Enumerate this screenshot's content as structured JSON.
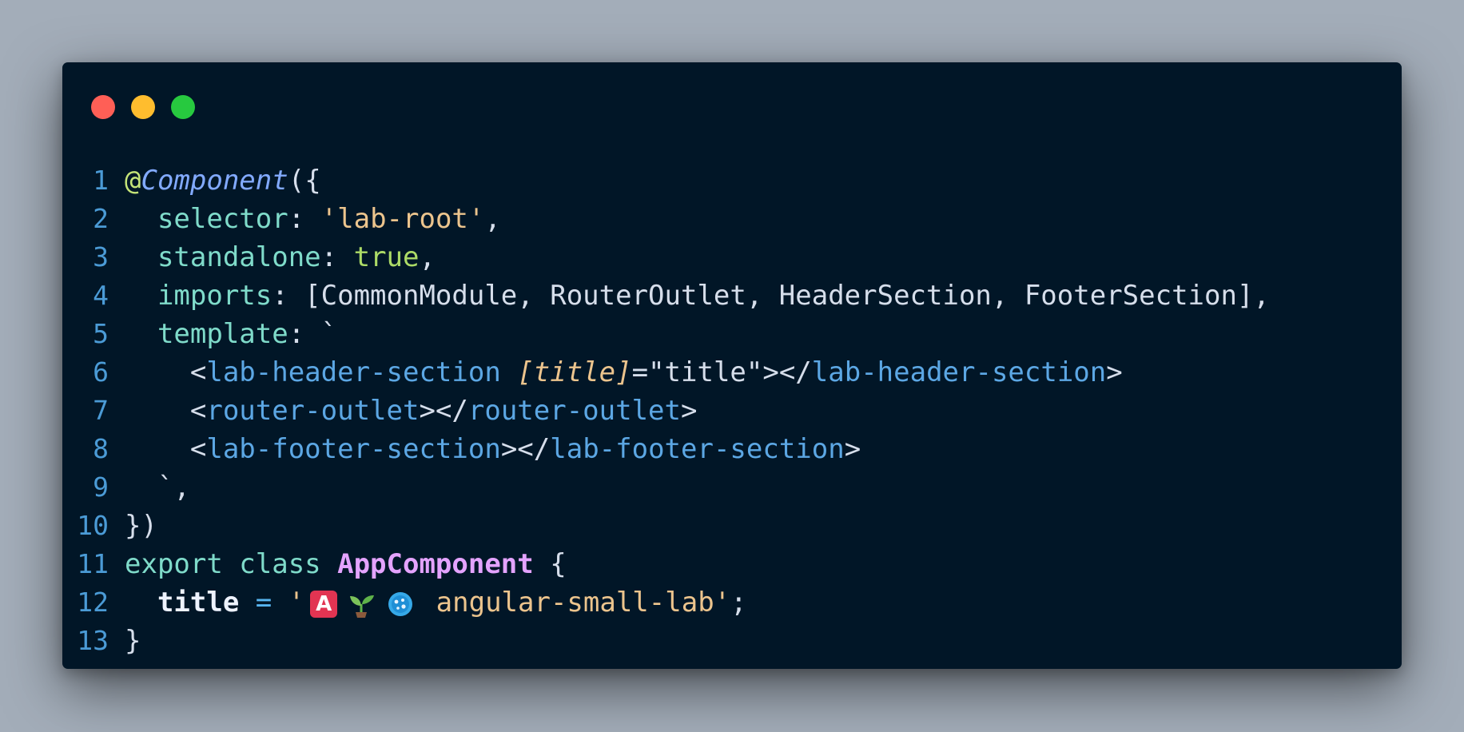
{
  "window": {
    "controls": [
      "close",
      "minimize",
      "maximize"
    ],
    "colors": {
      "close": "#ff5f56",
      "minimize": "#ffbd2e",
      "maximize": "#27c93f",
      "background": "#011627"
    }
  },
  "code": {
    "language": "typescript",
    "line_numbers": [
      "1",
      "2",
      "3",
      "4",
      "5",
      "6",
      "7",
      "8",
      "9",
      "10",
      "11",
      "12",
      "13"
    ],
    "lines": [
      [
        {
          "t": "at",
          "v": "@"
        },
        {
          "t": "decor",
          "v": "Component"
        },
        {
          "t": "punc",
          "v": "({"
        }
      ],
      [
        {
          "t": "prop",
          "v": "  selector"
        },
        {
          "t": "punc",
          "v": ": "
        },
        {
          "t": "str",
          "v": "'lab-root'"
        },
        {
          "t": "punc",
          "v": ","
        }
      ],
      [
        {
          "t": "prop",
          "v": "  standalone"
        },
        {
          "t": "punc",
          "v": ": "
        },
        {
          "t": "bool",
          "v": "true"
        },
        {
          "t": "punc",
          "v": ","
        }
      ],
      [
        {
          "t": "prop",
          "v": "  imports"
        },
        {
          "t": "punc",
          "v": ": [CommonModule, RouterOutlet, HeaderSection, FooterSection],"
        }
      ],
      [
        {
          "t": "prop",
          "v": "  template"
        },
        {
          "t": "punc",
          "v": ": `"
        }
      ],
      [
        {
          "t": "plain",
          "v": "    <"
        },
        {
          "t": "tagname",
          "v": "lab-header-section"
        },
        {
          "t": "plain",
          "v": " "
        },
        {
          "t": "attr",
          "v": "[title]"
        },
        {
          "t": "plain",
          "v": "=\"title\"></"
        },
        {
          "t": "tagname",
          "v": "lab-header-section"
        },
        {
          "t": "plain",
          "v": ">"
        }
      ],
      [
        {
          "t": "plain",
          "v": "    <"
        },
        {
          "t": "tagname",
          "v": "router-outlet"
        },
        {
          "t": "plain",
          "v": "></"
        },
        {
          "t": "tagname",
          "v": "router-outlet"
        },
        {
          "t": "plain",
          "v": ">"
        }
      ],
      [
        {
          "t": "plain",
          "v": "    <"
        },
        {
          "t": "tagname",
          "v": "lab-footer-section"
        },
        {
          "t": "plain",
          "v": "></"
        },
        {
          "t": "tagname",
          "v": "lab-footer-section"
        },
        {
          "t": "plain",
          "v": ">"
        }
      ],
      [
        {
          "t": "plain",
          "v": "  `,"
        }
      ],
      [
        {
          "t": "punc",
          "v": "})"
        }
      ],
      [
        {
          "t": "kw",
          "v": "export class "
        },
        {
          "t": "cls",
          "v": "AppComponent"
        },
        {
          "t": "punc",
          "v": " {"
        }
      ],
      [
        {
          "t": "var",
          "v": "  title"
        },
        {
          "t": "op",
          "v": " = "
        },
        {
          "t": "str",
          "v": "'"
        },
        {
          "t": "emoji",
          "v": "angular-logo-icon"
        },
        {
          "t": "emoji",
          "v": "seedling-icon"
        },
        {
          "t": "emoji",
          "v": "cookie-icon"
        },
        {
          "t": "str",
          "v": " angular-small-lab'"
        },
        {
          "t": "punc",
          "v": ";"
        }
      ],
      [
        {
          "t": "punc",
          "v": "}"
        }
      ]
    ]
  },
  "emoji_text": {
    "angular": "A"
  }
}
